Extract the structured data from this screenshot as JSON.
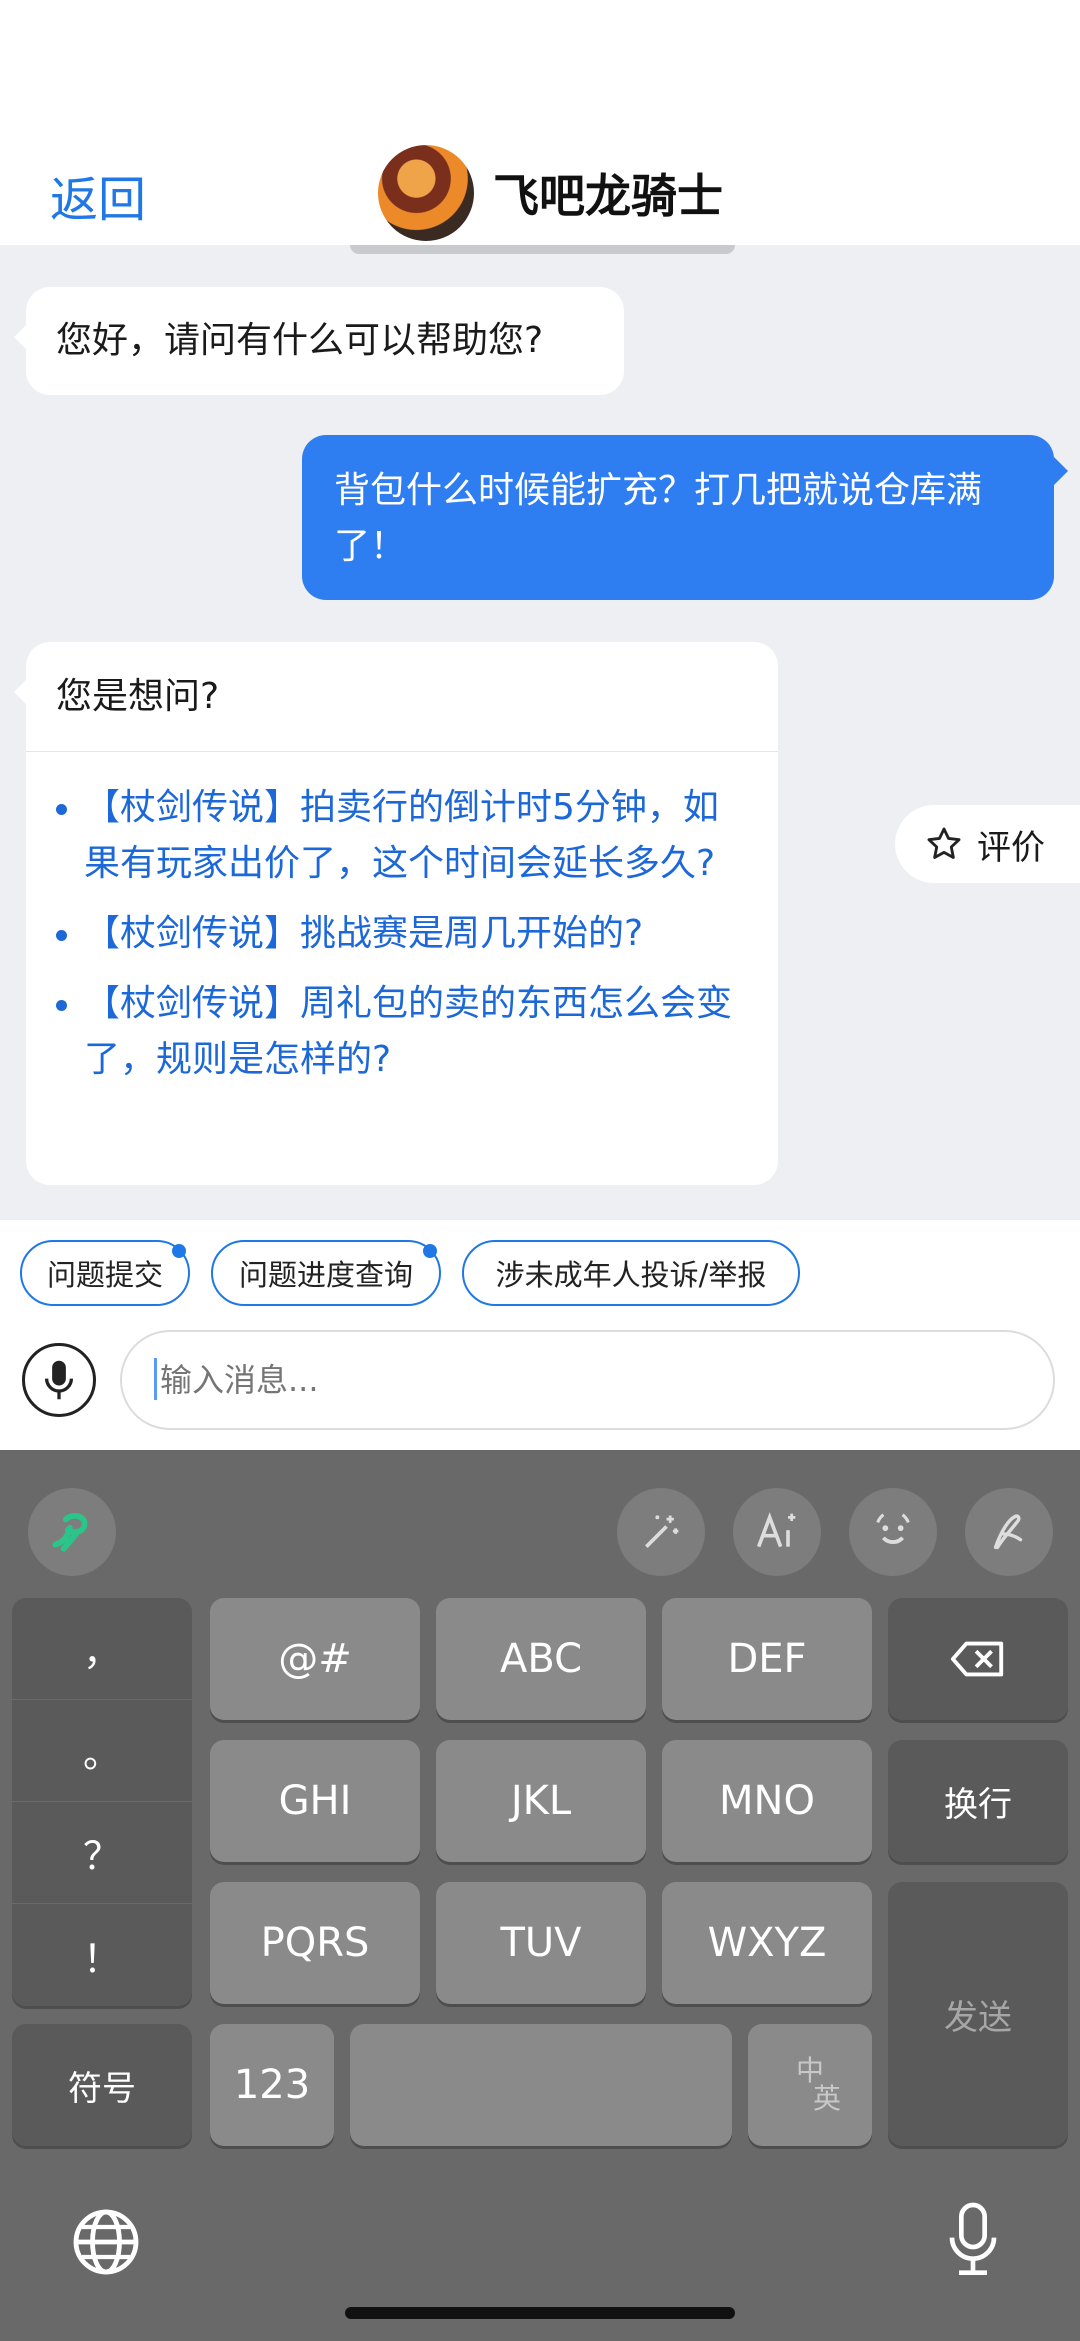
{
  "header": {
    "back_label": "返回",
    "title": "飞吧龙骑士"
  },
  "messages": {
    "bot_greeting": "您好，请问有什么可以帮助您?",
    "user_question": "背包什么时候能扩充？打几把就说仓库满了！",
    "bot_suggest_title": "您是想问?",
    "suggestions": [
      "【杖剑传说】拍卖行的倒计时5分钟，如果有玩家出价了，这个时间会延长多久?",
      "【杖剑传说】挑战赛是周几开始的?",
      "【杖剑传说】周礼包的卖的东西怎么会变了，规则是怎样的?"
    ]
  },
  "rate": {
    "label": "评价",
    "icon": "star-outline-icon"
  },
  "quick_actions": [
    "问题提交",
    "问题进度查询",
    "涉未成年人投诉/举报"
  ],
  "input": {
    "placeholder": "输入消息..."
  },
  "keyboard": {
    "punct": [
      "，",
      "。",
      "？",
      "！"
    ],
    "row1": [
      "@#",
      "ABC",
      "DEF"
    ],
    "row2": [
      "GHI",
      "JKL",
      "MNO"
    ],
    "row3": [
      "PQRS",
      "TUV",
      "WXYZ"
    ],
    "enter_label": "换行",
    "send_label": "发送",
    "symbol_label": "符号",
    "num_label": "123",
    "lang_top": "中",
    "lang_bottom": "英"
  },
  "colors": {
    "accent": "#1f78e6",
    "user_bubble": "#2f7ef1",
    "link": "#1d68d8",
    "keyboard_bg": "#696969"
  }
}
